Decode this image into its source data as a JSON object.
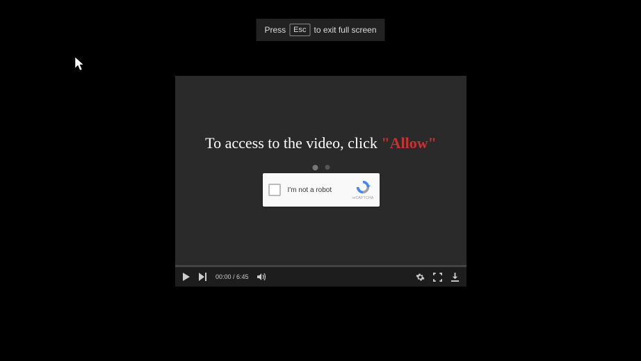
{
  "notice": {
    "press": "Press",
    "key": "Esc",
    "rest": "to exit full screen"
  },
  "overlay": {
    "prompt_prefix": "To access to the video, click ",
    "prompt_highlight": "\"Allow\""
  },
  "recaptcha": {
    "label": "I'm not a robot",
    "brand": "reCAPTCHA"
  },
  "controls": {
    "time_current": "00:00",
    "time_sep": " / ",
    "time_total": "6:45"
  }
}
